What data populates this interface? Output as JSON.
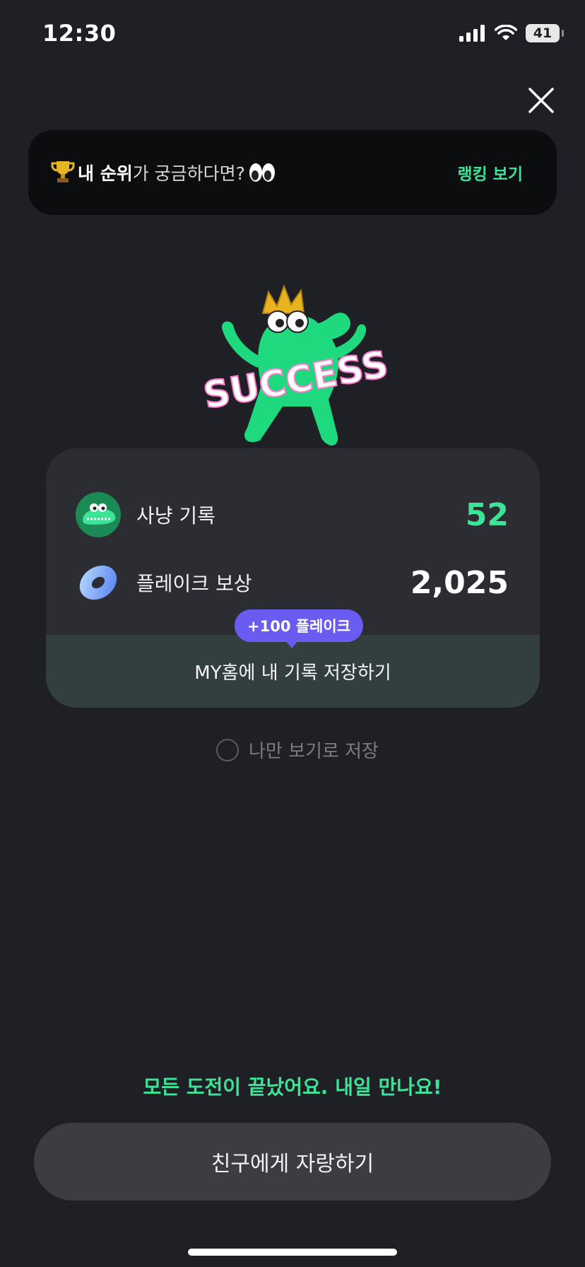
{
  "status_bar": {
    "time": "12:30",
    "battery": "41"
  },
  "ranking": {
    "prefix_bold": "내 순위",
    "suffix": "가 궁금하다면? ",
    "link": "랭킹 보기"
  },
  "mascot": {
    "badge_text": "SUCCESS"
  },
  "card": {
    "hunt_label": "사냥 기록",
    "hunt_value": "52",
    "reward_label": "플레이크 보상",
    "reward_value": "2,025",
    "bubble": "+100 플레이크",
    "save_label": "MY홈에 내 기록 저장하기"
  },
  "private_option": {
    "label": "나만 보기로 저장"
  },
  "footer": {
    "message": "모든 도전이 끝났어요. 내일 만나요!",
    "share_button": "친구에게 자랑하기"
  },
  "colors": {
    "accent": "#3de397",
    "bubble": "#6a5cf0",
    "background": "#1f2025"
  }
}
